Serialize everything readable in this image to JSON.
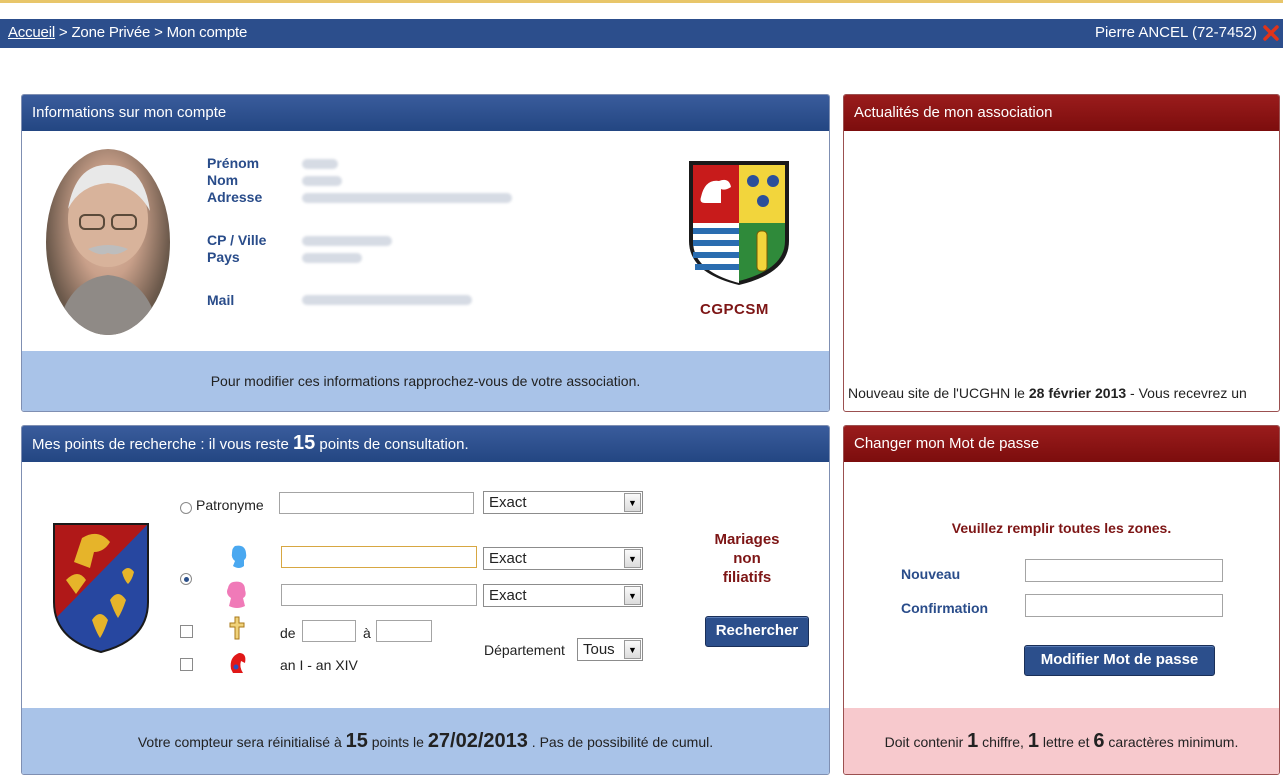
{
  "topbar": {
    "breadcrumb_home": "Accueil",
    "breadcrumb_rest": " > Zone Privée > Mon compte",
    "user": "Pierre ANCEL (72-7452)"
  },
  "account": {
    "title": "Informations sur mon compte",
    "labels": {
      "firstname": "Prénom",
      "lastname": "Nom",
      "address": "Adresse",
      "city": "CP / Ville",
      "country": "Pays",
      "mail": "Mail"
    },
    "association": "CGPCSM",
    "footer": "Pour modifier ces informations rapprochez-vous de votre association."
  },
  "news": {
    "title": "Actualités de mon association",
    "ticker_prefix": "Nouveau site de l'UCGHN le ",
    "ticker_date": "28 février 2013",
    "ticker_suffix": " - Vous recevrez un"
  },
  "search": {
    "title_prefix": "Mes points de recherche : il vous reste ",
    "points": "15",
    "title_suffix": " points de consultation.",
    "patronyme_label": "Patronyme",
    "match_options": [
      "Exact",
      "Exact",
      "Exact"
    ],
    "de_label": "de",
    "a_label": "à",
    "an_label": "an I - an XIV",
    "departement_label": "Département",
    "departement_value": "Tous",
    "mariages": [
      "Mariages",
      "non",
      "filiatifs"
    ],
    "search_button": "Rechercher",
    "footer_prefix": "Votre compteur sera réinitialisé à ",
    "footer_points": "15",
    "footer_mid": " points le ",
    "footer_date": "27/02/2013",
    "footer_suffix": " . Pas de possibilité de cumul."
  },
  "password": {
    "title": "Changer mon Mot de passe",
    "instruction": "Veuillez remplir toutes les zones.",
    "new_label": "Nouveau",
    "confirm_label": "Confirmation",
    "submit_button": "Modifier Mot de passe",
    "rule_prefix": "Doit contenir ",
    "rule_digits": "1",
    "rule_mid1": " chiffre, ",
    "rule_letters": "1",
    "rule_mid2": " lettre et ",
    "rule_chars": "6",
    "rule_suffix": " caractères minimum."
  },
  "colors": {
    "blue_header": "#2c4e8c",
    "red_header": "#8a1414",
    "blue_footer": "#a9c3e8",
    "pink_footer": "#f7c9cd"
  }
}
